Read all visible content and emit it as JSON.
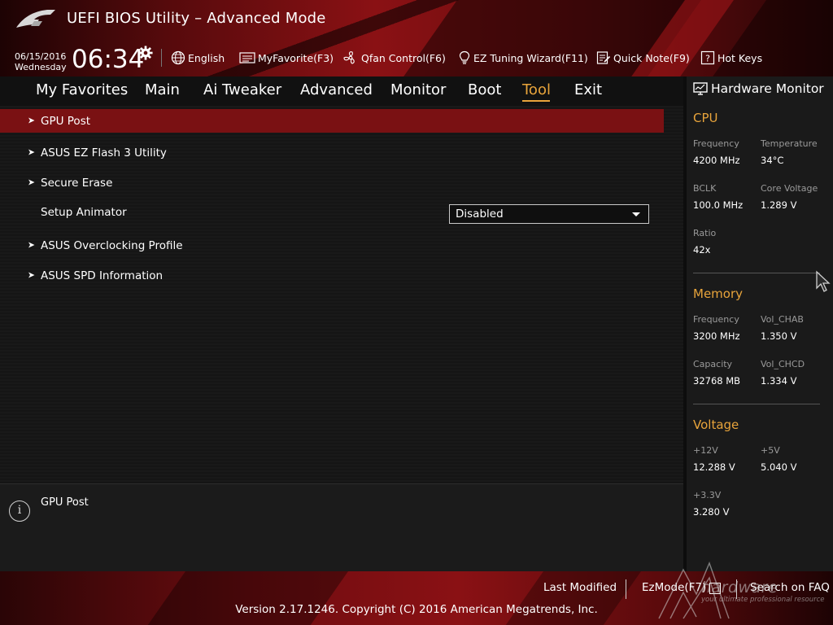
{
  "header": {
    "title": "UEFI BIOS Utility – Advanced Mode",
    "date": "06/15/2016",
    "weekday": "Wednesday",
    "time": "06:34",
    "tools": [
      {
        "label": "English",
        "icon": "globe-icon"
      },
      {
        "label": "MyFavorite(F3)",
        "icon": "favorite-list-icon"
      },
      {
        "label": "Qfan Control(F6)",
        "icon": "fan-icon"
      },
      {
        "label": "EZ Tuning Wizard(F11)",
        "icon": "lightbulb-icon"
      },
      {
        "label": "Quick Note(F9)",
        "icon": "note-icon"
      },
      {
        "label": "Hot Keys",
        "icon": "question-icon"
      }
    ]
  },
  "nav": {
    "tabs": [
      "My Favorites",
      "Main",
      "Ai Tweaker",
      "Advanced",
      "Monitor",
      "Boot",
      "Tool",
      "Exit"
    ],
    "active": "Tool"
  },
  "main": {
    "items": [
      {
        "label": "GPU Post",
        "submenu": true,
        "selected": true
      },
      {
        "label": "ASUS EZ Flash 3 Utility",
        "submenu": true
      },
      {
        "label": "Secure Erase",
        "submenu": true
      },
      {
        "label": "Setup Animator",
        "submenu": false,
        "value": "Disabled"
      },
      {
        "label": "ASUS Overclocking Profile",
        "submenu": true
      },
      {
        "label": "ASUS SPD Information",
        "submenu": true
      }
    ]
  },
  "help": {
    "text": "GPU Post",
    "icon": "info-icon"
  },
  "hardware_monitor": {
    "title": "Hardware Monitor",
    "icon": "monitor-icon",
    "cpu": {
      "heading": "CPU",
      "frequency_label": "Frequency",
      "frequency": "4200 MHz",
      "temperature_label": "Temperature",
      "temperature": "34°C",
      "bclk_label": "BCLK",
      "bclk": "100.0 MHz",
      "core_voltage_label": "Core Voltage",
      "core_voltage": "1.289 V",
      "ratio_label": "Ratio",
      "ratio": "42x"
    },
    "memory": {
      "heading": "Memory",
      "frequency_label": "Frequency",
      "frequency": "3200 MHz",
      "vol_chab_label": "Vol_CHAB",
      "vol_chab": "1.350 V",
      "capacity_label": "Capacity",
      "capacity": "32768 MB",
      "vol_chcd_label": "Vol_CHCD",
      "vol_chcd": "1.334 V"
    },
    "voltage": {
      "heading": "Voltage",
      "v12_label": "+12V",
      "v12": "12.288 V",
      "v5_label": "+5V",
      "v5": "5.040 V",
      "v33_label": "+3.3V",
      "v33": "3.280 V"
    }
  },
  "footer": {
    "last_modified": "Last Modified",
    "ezmode": "EzMode(F7)",
    "search": "Search on FAQ",
    "version": "Version 2.17.1246. Copyright (C) 2016 American Megatrends, Inc.",
    "watermark": "hardware",
    "watermark_sub": "your ultimate professional resource"
  },
  "colors": {
    "accent": "#e8a43b",
    "selected_row": "#7a1113",
    "banner_red": "#8a1114"
  }
}
